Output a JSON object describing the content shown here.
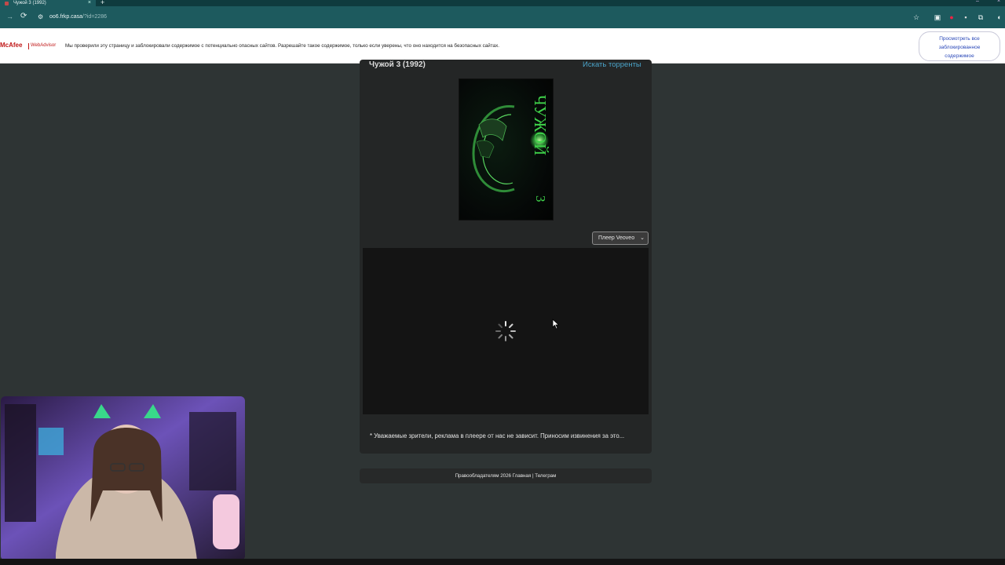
{
  "browser": {
    "tab_title": "Чужой 3 (1992)",
    "tab_close": "×",
    "new_tab": "+",
    "url_host": "oo6.frkp.casa",
    "url_path": "/?id=2286"
  },
  "mcafee": {
    "logo": "McAfee",
    "product": "WebAdvisor",
    "message": "Мы проверили эту страницу и заблокировали содержимое с потенциально опасных сайтов. Разрешайте такое содержимое, только если уверены, что оно находится на безопасных сайтах.",
    "button_line1": "Просмотреть все",
    "button_line2": "заблокированное",
    "button_line3": "содержимое"
  },
  "page": {
    "movie_title": "Чужой 3 (1992)",
    "torrents_link": "Искать торренты",
    "player_select": "Плеер Veoveo",
    "notice": "* Уважаемые зрители, реклама в плеере от нас не зависит. Приносим извинения за это...",
    "footer": "Правообладателям 2026 Главная | Телеграм"
  },
  "poster": {
    "title_glyphs": "ЧУЖОЙ",
    "number": "3"
  },
  "colors": {
    "page_bg": "#2e3434",
    "card_bg": "#242626",
    "link": "#4aa3c9",
    "alien_green": "#3fd34a"
  }
}
